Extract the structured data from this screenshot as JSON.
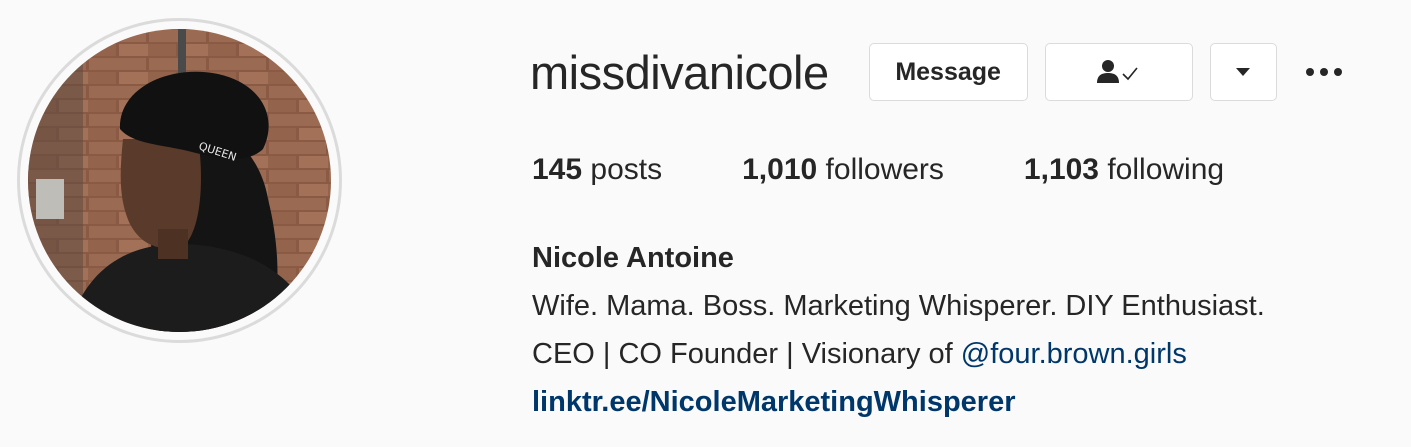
{
  "profile": {
    "username": "missdivanicole",
    "full_name": "Nicole Antoine",
    "bio_line_1": "Wife. Mama. Boss. Marketing Whisperer. DIY Enthusiast.",
    "bio_line_2_prefix": "CEO | CO Founder | Visionary of ",
    "bio_mention": "@four.brown.girls",
    "link": "linktr.ee/NicoleMarketingWhisperer",
    "avatar_hat_text": "QUEEN"
  },
  "actions": {
    "message_label": "Message",
    "following_icon": "person-check-icon",
    "dropdown_icon": "caret-down-icon",
    "more_icon": "more-horizontal-icon"
  },
  "stats": {
    "posts_count": "145",
    "posts_label": "posts",
    "followers_count": "1,010",
    "followers_label": "followers",
    "following_count": "1,103",
    "following_label": "following"
  },
  "colors": {
    "background": "#fafafa",
    "text": "#262626",
    "link": "#00376b",
    "border": "#dbdbdb"
  }
}
